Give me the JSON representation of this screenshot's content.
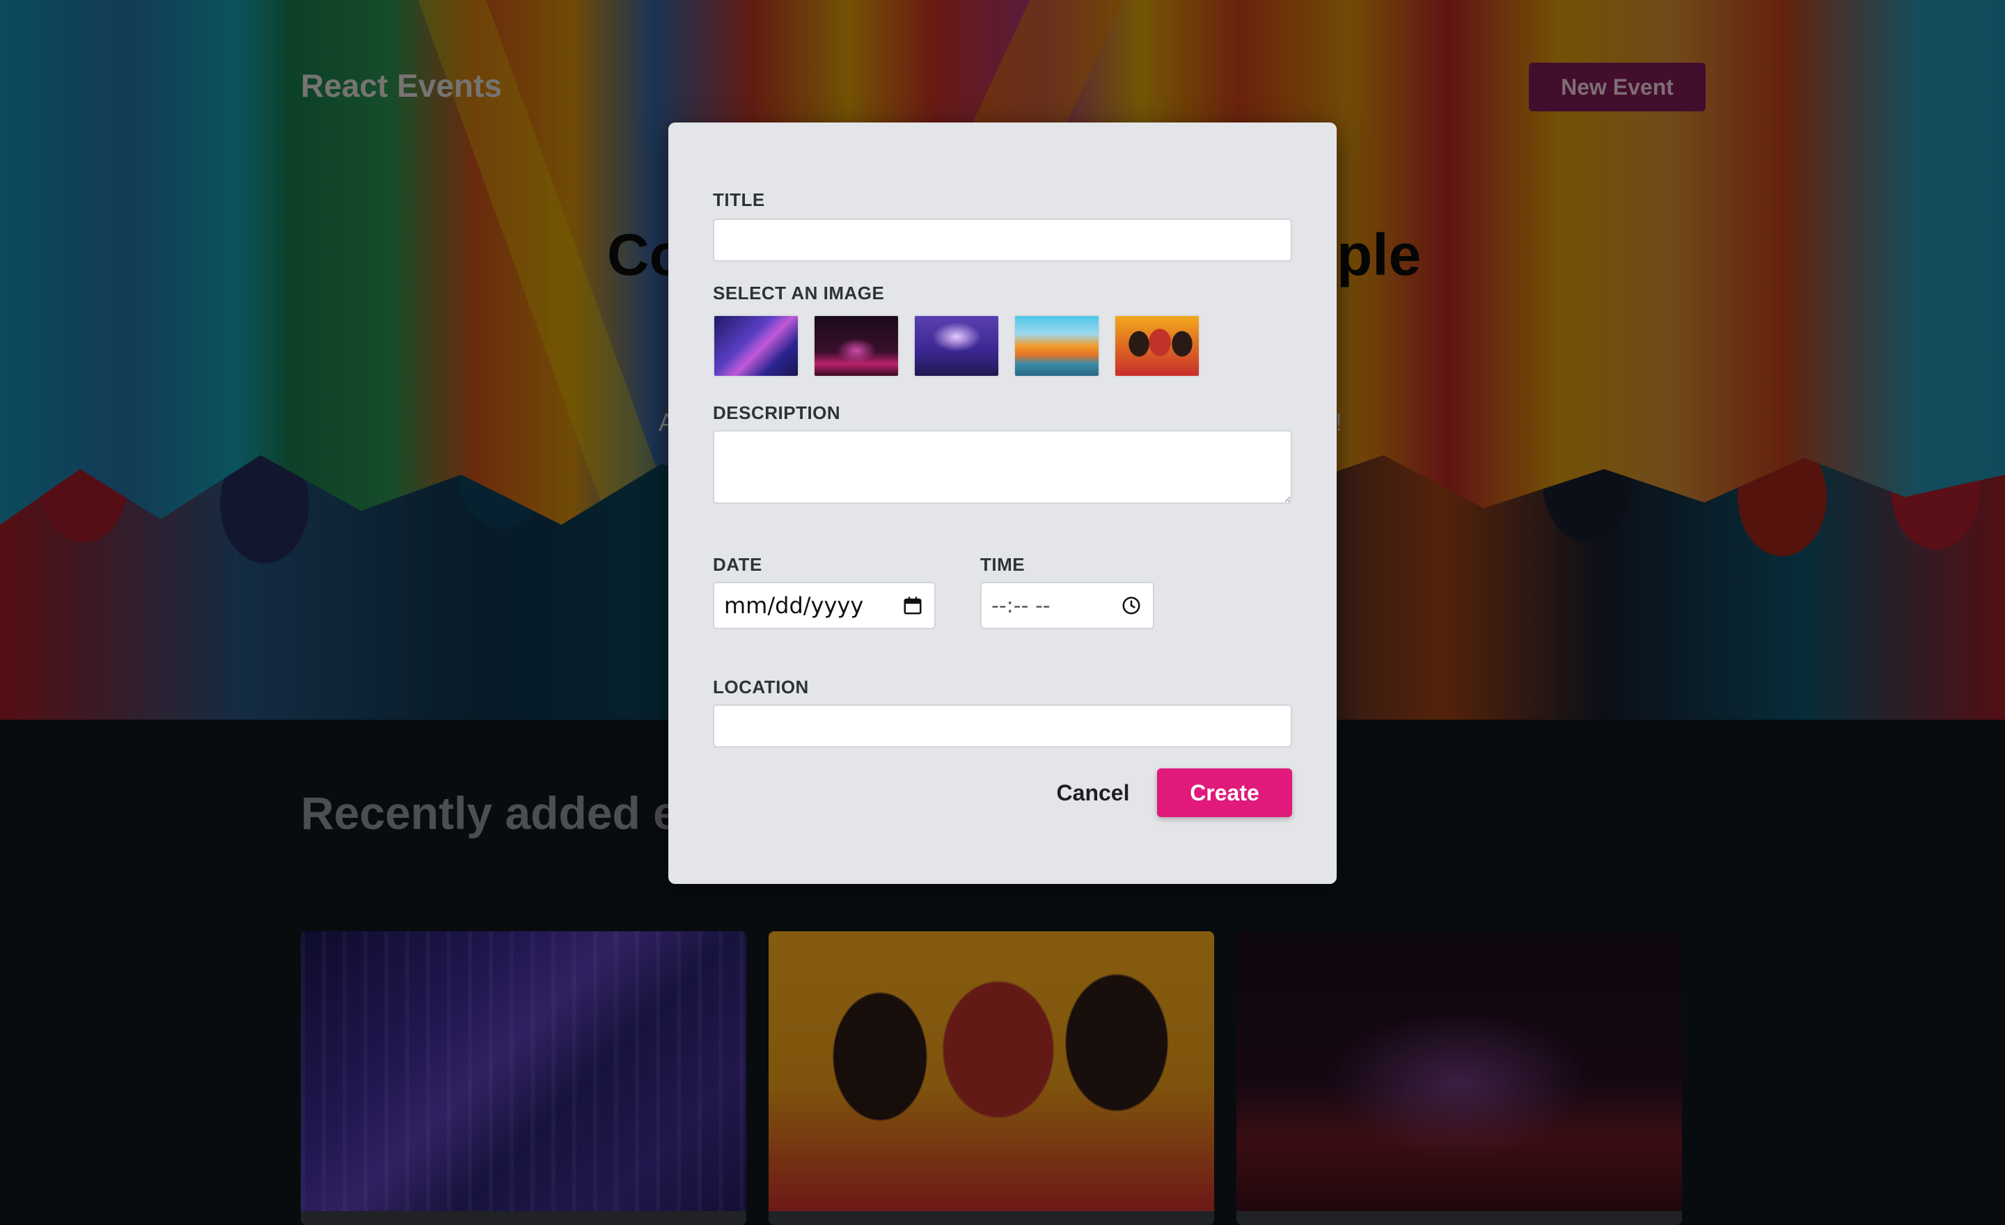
{
  "header": {
    "brand": "React Events",
    "new_event_label": "New Event"
  },
  "hero": {
    "title_visible_left": "Co",
    "title_visible_right": "ple",
    "subtitle_visible_left": "A",
    "subtitle_visible_right": "!"
  },
  "recent": {
    "title_visible": "Recently added e",
    "cards": [
      {
        "image": "city-night-crowd"
      },
      {
        "image": "three-women-laptops"
      },
      {
        "image": "laptop-desk-night"
      }
    ]
  },
  "modal": {
    "title_label": "TITLE",
    "title_value": "",
    "image_label": "SELECT AN IMAGE",
    "images": [
      "city-night",
      "laptop-pink",
      "concert-crowd",
      "city-river",
      "women-laptops"
    ],
    "description_label": "DESCRIPTION",
    "description_value": "",
    "date_label": "DATE",
    "date_placeholder": "mm/dd/yyyy",
    "time_label": "TIME",
    "time_placeholder": "--:-- --",
    "location_label": "LOCATION",
    "location_value": "",
    "cancel_label": "Cancel",
    "create_label": "Create"
  },
  "colors": {
    "accent": "#e0197a",
    "modal_bg": "#e3e5e8",
    "page_bg": "#11161c"
  }
}
